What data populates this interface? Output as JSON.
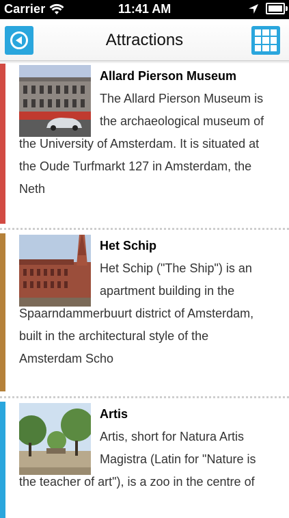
{
  "status_bar": {
    "carrier": "Carrier",
    "time": "11:41 AM",
    "icons": [
      "wifi-icon",
      "location-arrow-icon",
      "battery-icon"
    ]
  },
  "nav": {
    "title": "Attractions",
    "back_icon": "back-circle-icon",
    "grid_icon": "grid-menu-icon",
    "accent_color": "#2aa6dd"
  },
  "attractions": [
    {
      "title": "Allard Pierson Museum",
      "description": "The Allard Pierson Museum is the archaeological museum of the University of Amsterdam. It is situated at the Oude Turfmarkt 127 in Amsterdam, the Neth",
      "accent_color": "#d24b43"
    },
    {
      "title": "Het Schip",
      "description": "Het Schip (\"The Ship\") is an apartment building in the Spaarndammerbuurt district of Amsterdam, built in the architectural style of the Amsterdam Scho",
      "accent_color": "#b5813a"
    },
    {
      "title": "Artis",
      "description": "Artis, short for Natura Artis Magistra (Latin for \"Nature is the teacher of art\"), is a zoo in the centre of",
      "accent_color": "#2aa6dd"
    }
  ]
}
